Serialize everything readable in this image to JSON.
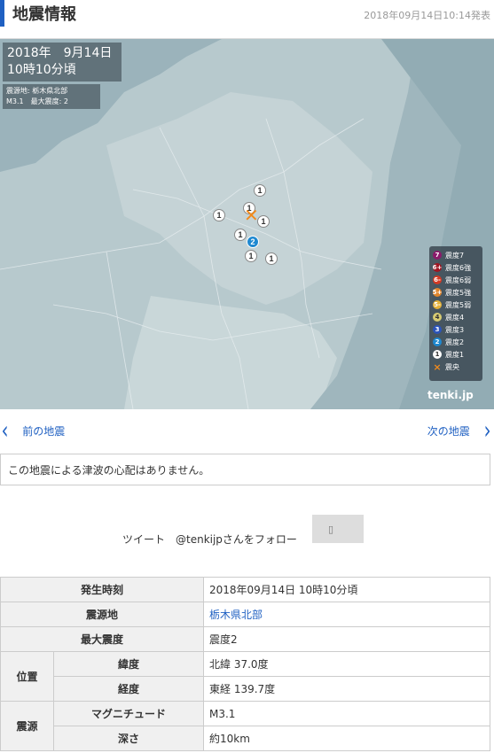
{
  "header": {
    "title": "地震情報",
    "timestamp": "2018年09月14日10:14発表"
  },
  "map": {
    "date_line1": "2018年　9月14日",
    "date_line2": "10時10分頃",
    "epicenter_label": "震源地: 栃木県北部",
    "magnitude_label": "M3.1　最大震度: 2",
    "markers": [
      {
        "value": "1"
      },
      {
        "value": "1"
      },
      {
        "value": "1"
      },
      {
        "value": "1"
      },
      {
        "value": "1"
      },
      {
        "value": "2"
      },
      {
        "value": "1"
      },
      {
        "value": "1"
      }
    ],
    "legend": [
      {
        "mark": "7",
        "label": "震度7",
        "color": "#8b1a6b"
      },
      {
        "mark": "6+",
        "label": "震度6強",
        "color": "#a01622"
      },
      {
        "mark": "6-",
        "label": "震度6弱",
        "color": "#d43a23"
      },
      {
        "mark": "5+",
        "label": "震度5強",
        "color": "#e0852c"
      },
      {
        "mark": "5-",
        "label": "震度5弱",
        "color": "#e3b13a"
      },
      {
        "mark": "4",
        "label": "震度4",
        "color": "#d8cc72"
      },
      {
        "mark": "3",
        "label": "震度3",
        "color": "#2c54b9"
      },
      {
        "mark": "2",
        "label": "震度2",
        "color": "#1e88d0"
      },
      {
        "mark": "1",
        "label": "震度1",
        "color": "#ffffff"
      },
      {
        "mark": "×",
        "label": "震央",
        "color": "#f28a1b"
      }
    ],
    "brand": "tenki.jp"
  },
  "nav": {
    "prev_label": "前の地震",
    "next_label": "次の地震"
  },
  "tsunami_text": "この地震による津波の心配はありません。",
  "social": {
    "tweet_label": "ツイート",
    "follow_label": "@tenkijpさんをフォロー"
  },
  "details": {
    "time_label": "発生時刻",
    "time_value": "2018年09月14日 10時10分頃",
    "source_label": "震源地",
    "source_value": "栃木県北部",
    "max_label": "最大震度",
    "max_value": "震度2",
    "position_label": "位置",
    "lat_label": "緯度",
    "lat_value": "北緯 37.0度",
    "lon_label": "経度",
    "lon_value": "東経 139.7度",
    "hypo_label": "震源",
    "mag_label": "マグニチュード",
    "mag_value": "M3.1",
    "depth_label": "深さ",
    "depth_value": "約10km"
  }
}
